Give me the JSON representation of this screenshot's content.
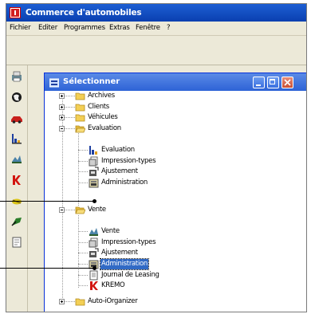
{
  "app": {
    "title": "Commerce d'automobiles",
    "menu": [
      "Fichier",
      "Editer",
      "Programmes",
      "Extras",
      "Fenêtre",
      "?"
    ]
  },
  "toolbar": {
    "buttons": [
      "printer-icon",
      "globe-icon",
      "car-icon",
      "chart-icon",
      "wrench-icon",
      "k-icon",
      "scissors-icon",
      "paint-icon",
      "document-icon"
    ]
  },
  "dialog": {
    "title": "Sélectionner",
    "window_buttons": [
      "minimize",
      "maximize",
      "close"
    ]
  },
  "tree": {
    "items": [
      {
        "label": "Archives",
        "level": 0,
        "icon": "folder-icon",
        "expander": "plus"
      },
      {
        "label": "Clients",
        "level": 0,
        "icon": "folder-icon",
        "expander": "plus"
      },
      {
        "label": "Véhicules",
        "level": 0,
        "icon": "folder-icon",
        "expander": "plus"
      },
      {
        "label": "Evaluation",
        "level": 0,
        "icon": "folder-open-icon",
        "expander": "minus"
      },
      {
        "label": "Evaluation",
        "level": 1,
        "icon": "chart-icon"
      },
      {
        "label": "Impression-types",
        "level": 1,
        "icon": "print-types-icon"
      },
      {
        "label": "Ajustement",
        "level": 1,
        "icon": "adjust-icon"
      },
      {
        "label": "Administration",
        "level": 1,
        "icon": "admin-icon"
      },
      {
        "label": "Vente",
        "level": 0,
        "icon": "folder-open-icon",
        "expander": "minus"
      },
      {
        "label": "Vente",
        "level": 1,
        "icon": "sale-icon"
      },
      {
        "label": "Impression-types",
        "level": 1,
        "icon": "print-types-icon"
      },
      {
        "label": "Ajustement",
        "level": 1,
        "icon": "adjust-icon"
      },
      {
        "label": "Administration",
        "level": 1,
        "icon": "admin-icon",
        "selected": true
      },
      {
        "label": "Journal de Leasing",
        "level": 1,
        "icon": "journal-icon"
      },
      {
        "label": "KREMO",
        "level": 1,
        "icon": "k-icon"
      },
      {
        "label": "Auto-iOrganizer",
        "level": 0,
        "icon": "folder-icon",
        "expander": "plus"
      }
    ]
  },
  "colors": {
    "titlebar": "#0a3fb0",
    "dialog_titlebar": "#2e63d6",
    "selection": "#316ac5",
    "folder": "#f3cf55"
  }
}
